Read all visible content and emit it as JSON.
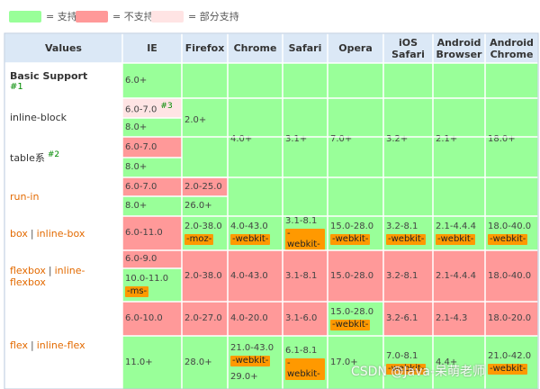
{
  "colors": {
    "supported": "#99ff99",
    "unsupported": "#ff9999",
    "partial": "#ffe4e4",
    "header": "#dbe8f6",
    "prefix": "#ff9900",
    "link": "#e36a00"
  },
  "legend": [
    {
      "status": "yes",
      "label": "= 支持"
    },
    {
      "status": "no",
      "label": "= 不支持"
    },
    {
      "status": "partial",
      "label": "= 部分支持"
    }
  ],
  "headers": [
    "Values",
    "IE",
    "Firefox",
    "Chrome",
    "Safari",
    "Opera",
    "iOS Safari",
    "Android Browser",
    "Android Chrome"
  ],
  "features": [
    {
      "id": "basic",
      "text": "Basic Support",
      "note": "#1"
    },
    {
      "id": "inline-block",
      "text": "inline-block"
    },
    {
      "id": "table",
      "text": "table系",
      "note": "#2"
    },
    {
      "id": "run-in",
      "text": "run-in"
    },
    {
      "id": "box",
      "text": "box",
      "sep": "|",
      "text2": "inline-box"
    },
    {
      "id": "flexbox",
      "text": "flexbox",
      "sep": "|",
      "text2": "inline-flexbox"
    },
    {
      "id": "flex",
      "text": "flex",
      "sep": "|",
      "text2": "inline-flex"
    }
  ],
  "cells": [
    {
      "id": "ie-basic",
      "status": "yes",
      "text": "6.0+"
    },
    {
      "id": "ie-ib-1",
      "status": "partial",
      "text": "6.0-7.0",
      "note": "#3"
    },
    {
      "id": "ie-ib-2",
      "status": "yes",
      "text": "8.0+"
    },
    {
      "id": "ie-tb-1",
      "status": "no",
      "text": "6.0-7.0"
    },
    {
      "id": "ie-tb-2",
      "status": "yes",
      "text": "8.0+"
    },
    {
      "id": "ie-ri-1",
      "status": "no",
      "text": "6.0-7.0"
    },
    {
      "id": "ie-ri-2",
      "status": "yes",
      "text": "8.0+"
    },
    {
      "id": "ie-box",
      "status": "no",
      "text": "6.0-11.0"
    },
    {
      "id": "ie-fb-1",
      "status": "no",
      "text": "6.0-9.0"
    },
    {
      "id": "ie-fb-2",
      "status": "yes",
      "text": "10.0-11.0",
      "prefix": "-ms-"
    },
    {
      "id": "ie-fx-1",
      "status": "no",
      "text": "6.0-10.0"
    },
    {
      "id": "ie-fx-2",
      "status": "yes",
      "text": "11.0+"
    },
    {
      "id": "ff-top",
      "status": "yes",
      "text": "2.0+"
    },
    {
      "id": "ff-ri-1",
      "status": "no",
      "text": "2.0-25.0"
    },
    {
      "id": "ff-ri-2",
      "status": "yes",
      "text": "26.0+"
    },
    {
      "id": "ff-box",
      "status": "yes",
      "text": "2.0-38.0",
      "prefix": "-moz-"
    },
    {
      "id": "ff-fb",
      "status": "no",
      "text": "2.0-38.0"
    },
    {
      "id": "ff-fx-1",
      "status": "no",
      "text": "2.0-27.0"
    },
    {
      "id": "ff-fx-2",
      "status": "yes",
      "text": "28.0+"
    },
    {
      "id": "ch-top",
      "status": "yes",
      "text": "4.0+"
    },
    {
      "id": "ch-box",
      "status": "yes",
      "text": "4.0-43.0",
      "prefix": "-webkit-"
    },
    {
      "id": "ch-fb",
      "status": "no",
      "text": "4.0-43.0"
    },
    {
      "id": "ch-fx-1",
      "status": "no",
      "text": "4.0-20.0"
    },
    {
      "id": "ch-fx-2",
      "status": "yes",
      "text": "21.0-43.0",
      "prefix": "-webkit-",
      "text2": "29.0+"
    },
    {
      "id": "sa-top",
      "status": "yes",
      "text": "3.1+"
    },
    {
      "id": "sa-box",
      "status": "yes",
      "text": "3.1-8.1",
      "prefix": "-webkit-"
    },
    {
      "id": "sa-fb",
      "status": "no",
      "text": "3.1-8.1"
    },
    {
      "id": "sa-fx-1",
      "status": "no",
      "text": "3.1-6.0"
    },
    {
      "id": "sa-fx-2",
      "status": "yes",
      "text": "6.1-8.1",
      "prefix": "-webkit-"
    },
    {
      "id": "op-top",
      "status": "yes",
      "text": "7.0+"
    },
    {
      "id": "op-box",
      "status": "yes",
      "text": "15.0-28.0",
      "prefix": "-webkit-"
    },
    {
      "id": "op-fb",
      "status": "no",
      "text": "15.0-28.0"
    },
    {
      "id": "op-fx-1",
      "status": "yes",
      "text": "15.0-28.0",
      "prefix": "-webkit-"
    },
    {
      "id": "op-fx-2",
      "status": "yes",
      "text": "17.0+"
    },
    {
      "id": "ios-top",
      "status": "yes",
      "text": "3.2+"
    },
    {
      "id": "ios-box",
      "status": "yes",
      "text": "3.2-8.1",
      "prefix": "-webkit-"
    },
    {
      "id": "ios-fb",
      "status": "no",
      "text": "3.2-8.1"
    },
    {
      "id": "ios-fx-1",
      "status": "no",
      "text": "3.2-6.1"
    },
    {
      "id": "ios-fx-2",
      "status": "yes",
      "text": "7.0-8.1",
      "prefix": "-webkit-"
    },
    {
      "id": "ab-top",
      "status": "yes",
      "text": "2.1+"
    },
    {
      "id": "ab-box",
      "status": "yes",
      "text": "2.1-4.4.4",
      "prefix": "-webkit-"
    },
    {
      "id": "ab-fb",
      "status": "no",
      "text": "2.1-4.4.4"
    },
    {
      "id": "ab-fx-1",
      "status": "no",
      "text": "2.1-4.3"
    },
    {
      "id": "ab-fx-2",
      "status": "yes",
      "text": "4.4+"
    },
    {
      "id": "ac-top",
      "status": "yes",
      "text": "18.0+"
    },
    {
      "id": "ac-box",
      "status": "yes",
      "text": "18.0-40.0",
      "prefix": "-webkit-"
    },
    {
      "id": "ac-fb",
      "status": "no",
      "text": "18.0-40.0"
    },
    {
      "id": "ac-fx-1",
      "status": "no",
      "text": "18.0-20.0"
    },
    {
      "id": "ac-fx-2",
      "status": "yes",
      "text": "21.0-42.0",
      "prefix": "-webkit-"
    }
  ],
  "watermark": "CSDN @Java-呆萌老师"
}
